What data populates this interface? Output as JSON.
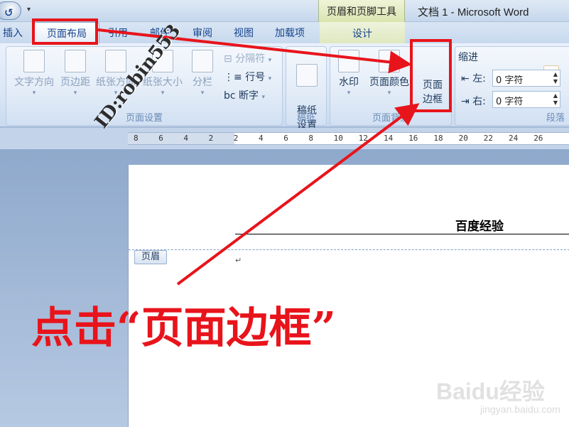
{
  "titlebar": {
    "context_tool_title": "页眉和页脚工具",
    "window_title": "文档 1 - Microsoft Word",
    "qat_dropdown": "▾"
  },
  "tabs": {
    "insert": "插入",
    "page_layout": "页面布局",
    "references": "引用",
    "mailings": "邮件",
    "review": "审阅",
    "view": "视图",
    "addins": "加载项",
    "design": "设计"
  },
  "ribbon": {
    "page_setup": {
      "text_direction": "文字方向",
      "margins": "页边距",
      "orientation": "纸张方向",
      "size": "纸张大小",
      "columns": "分栏",
      "breaks": "分隔符",
      "line_numbers": "行号",
      "hyphenation": "断字",
      "label": "页面设置"
    },
    "manuscript": {
      "settings": "稿纸\n设置",
      "label": "稿纸"
    },
    "page_background": {
      "watermark": "水印",
      "page_color": "页面颜色",
      "page_borders": "页面\n边框",
      "label": "页面背景"
    },
    "paragraph": {
      "indent_title": "缩进",
      "left_label": "左:",
      "left_value": "0 字符",
      "right_label": "右:",
      "right_value": "0 字符",
      "label": "段落"
    }
  },
  "ruler": {
    "numbers": [
      "8",
      "6",
      "4",
      "2",
      "2",
      "4",
      "6",
      "8",
      "10",
      "12",
      "14",
      "16",
      "18",
      "20",
      "22",
      "24",
      "26"
    ]
  },
  "document": {
    "header_text": "百度经验",
    "header_tag": "页眉",
    "para_mark": "↵"
  },
  "annotation": {
    "watermark_text": "ID:robin553",
    "caption": "点击“页面边框”",
    "color": "#e8141b"
  },
  "logo": {
    "main": "Baidu经验",
    "sub": "jingyan.baidu.com"
  }
}
